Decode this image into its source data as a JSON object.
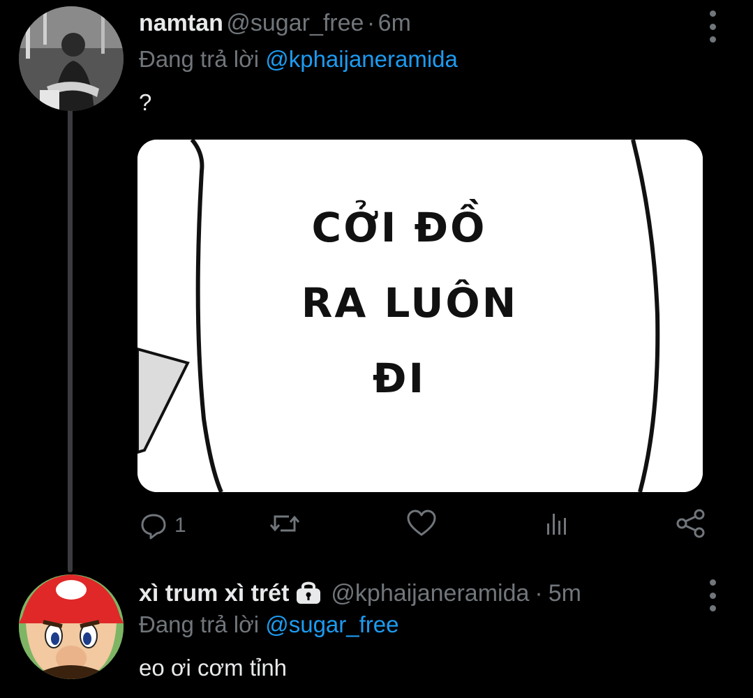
{
  "tweet1": {
    "display_name": "namtan",
    "handle": "@sugar_free",
    "separator": "·",
    "time": "6m",
    "reply_prefix": "Đang trả lời",
    "reply_to": "@kphaijaneramida",
    "text": "?",
    "media_text": {
      "line1": "CỞI ĐỒ",
      "line2": "RA LUÔN",
      "line3": "ĐI"
    },
    "actions": {
      "reply_count": "1",
      "retweet_icon": "retweet-icon",
      "like_icon": "heart-icon",
      "stats_icon": "bar-chart-icon",
      "share_icon": "share-icon"
    }
  },
  "tweet2": {
    "display_name": "xì trum xì trét",
    "handle": "@kphaijaneramida",
    "separator": "·",
    "time": "5m",
    "reply_prefix": "Đang trả lời",
    "reply_to": "@sugar_free",
    "text": "eo ơi cơm tỉnh"
  },
  "colors": {
    "background": "#000000",
    "link": "#1d9bf0",
    "muted": "#71767b",
    "text": "#e7e9ea"
  }
}
